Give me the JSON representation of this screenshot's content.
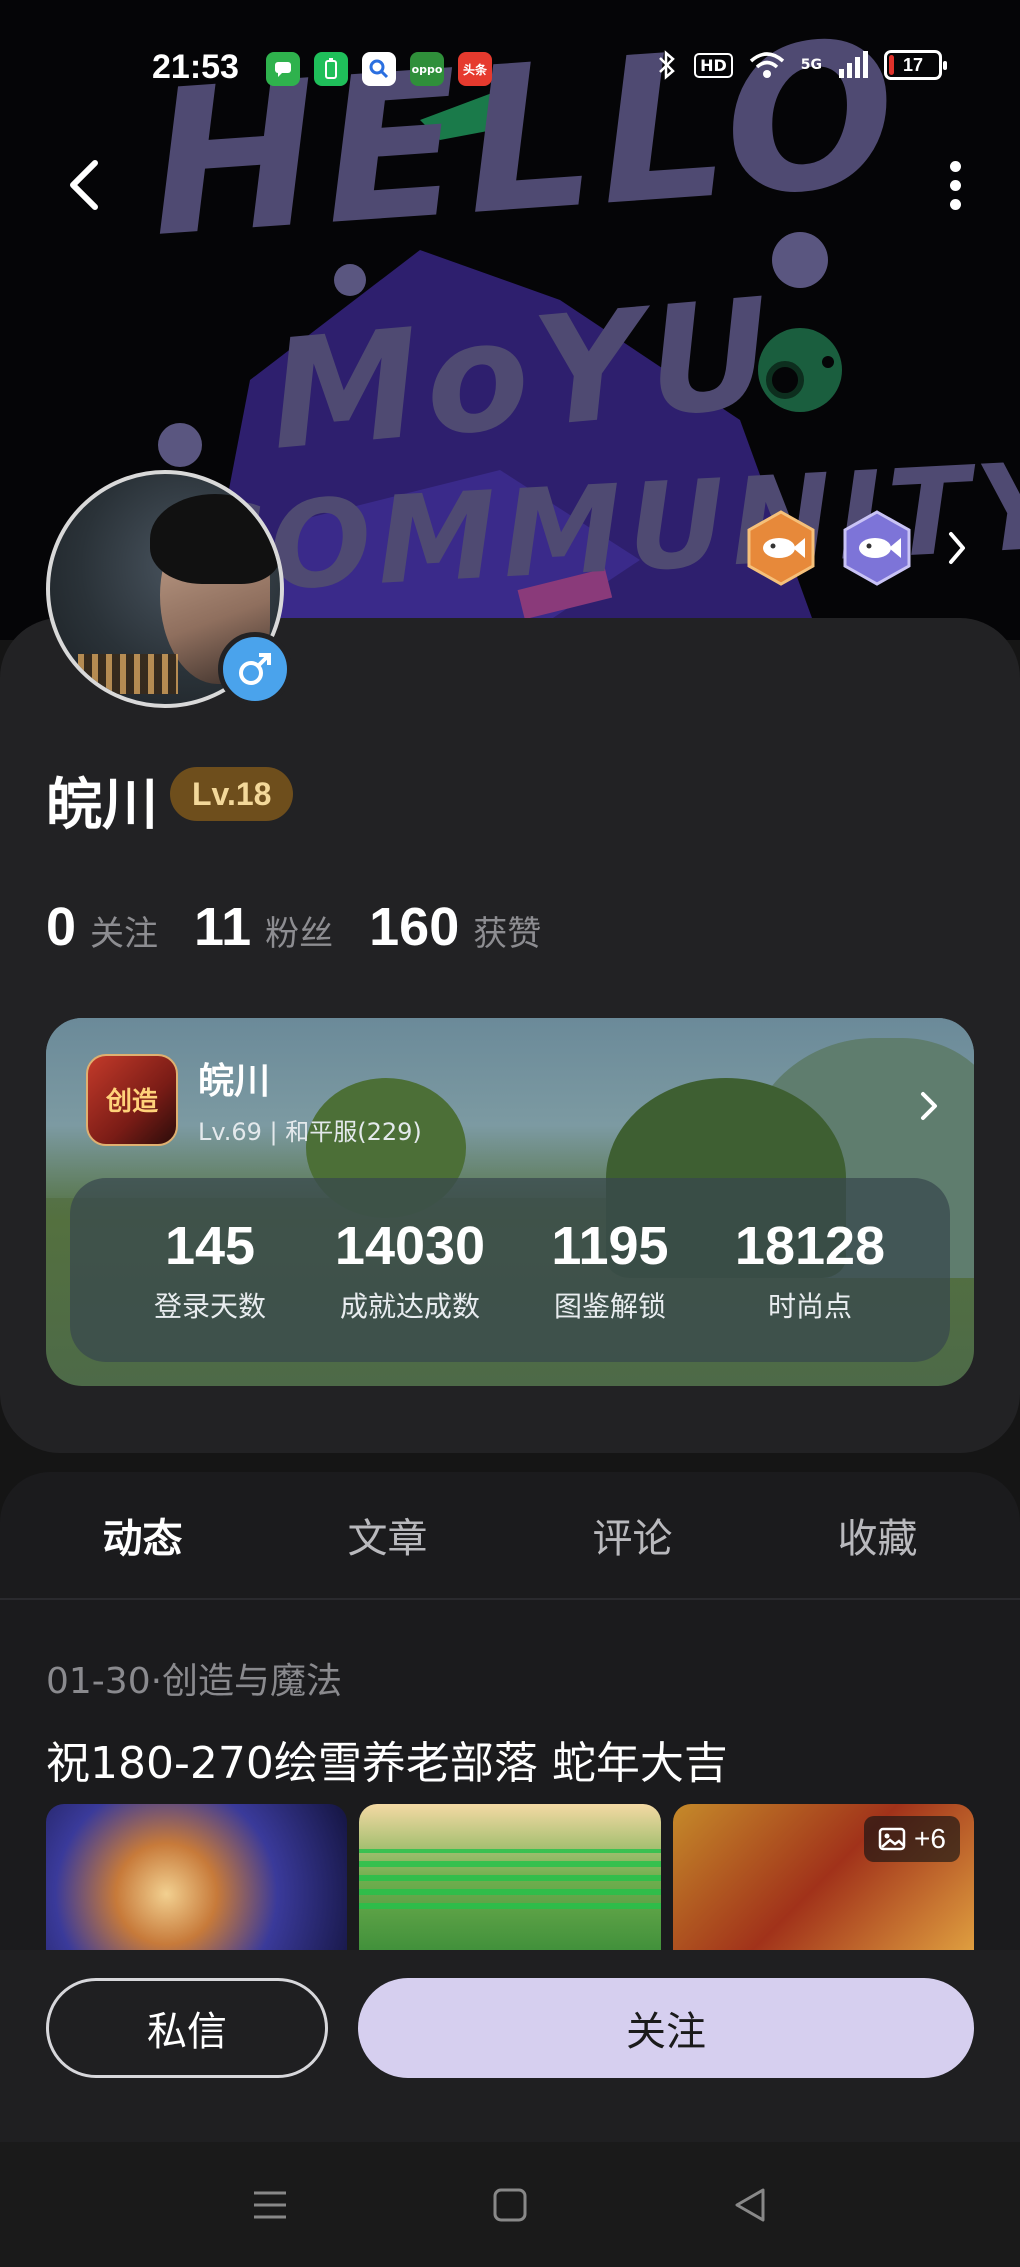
{
  "status_bar": {
    "time": "21:53",
    "apps": [
      {
        "name": "messages-app-icon",
        "label": "",
        "color": "#2fb24d"
      },
      {
        "name": "battery-app-icon",
        "label": "",
        "color": "#1fbf5a"
      },
      {
        "name": "search-app-icon",
        "label": "",
        "color": "#ffffff"
      },
      {
        "name": "oppo-app-icon",
        "label": "oppo",
        "color": "#2f8f3a"
      },
      {
        "name": "toutiao-app-icon",
        "label": "头条",
        "color": "#e63a2e"
      }
    ],
    "hd": "HD",
    "signal": "5G",
    "battery": "17",
    "battery_color": "#e0322b"
  },
  "banner": {
    "line1": "HELLO",
    "line2": "MoYU",
    "line3": "COMMUNITY"
  },
  "profile": {
    "username": "皖川",
    "level": "Lv.18",
    "stats": [
      {
        "num": "0",
        "label": "关注"
      },
      {
        "num": "11",
        "label": "粉丝"
      },
      {
        "num": "160",
        "label": "获赞"
      }
    ]
  },
  "game_card": {
    "name": "皖川",
    "subtitle": "Lv.69 | 和平服(229)",
    "icon_text": "创造",
    "stats": [
      {
        "num": "145",
        "label": "登录天数"
      },
      {
        "num": "14030",
        "label": "成就达成数"
      },
      {
        "num": "1195",
        "label": "图鉴解锁"
      },
      {
        "num": "18128",
        "label": "时尚点"
      }
    ]
  },
  "tabs": [
    {
      "label": "动态",
      "active": true
    },
    {
      "label": "文章",
      "active": false
    },
    {
      "label": "评论",
      "active": false
    },
    {
      "label": "收藏",
      "active": false
    }
  ],
  "post": {
    "meta": "01-30·创造与魔法",
    "title": "祝180-270绘雪养老部落 蛇年大吉",
    "more_images": "+6"
  },
  "actions": {
    "message": "私信",
    "follow": "关注"
  },
  "colors": {
    "accent": "#d6cfef",
    "gender": "#4aa3ec",
    "level_pill": "#6e4e1c",
    "tab_underline": "#5a52b0"
  }
}
